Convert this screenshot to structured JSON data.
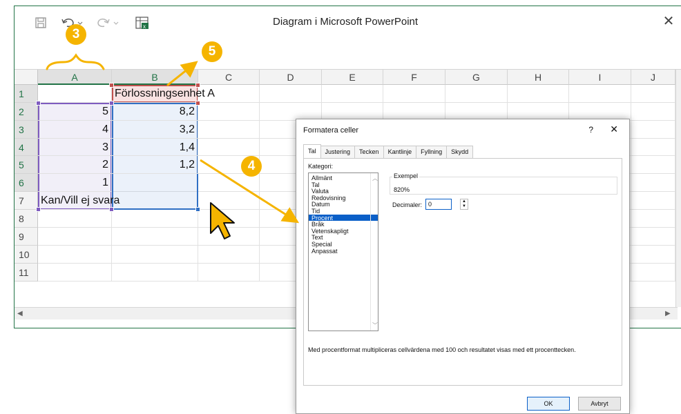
{
  "window": {
    "title": "Diagram i Microsoft PowerPoint",
    "close": "✕"
  },
  "columns": [
    "A",
    "B",
    "C",
    "D",
    "E",
    "F",
    "G",
    "H",
    "I",
    "J"
  ],
  "rows": [
    "1",
    "2",
    "3",
    "4",
    "5",
    "6",
    "7",
    "8",
    "9",
    "10",
    "11"
  ],
  "cells": {
    "B1": "Förlossningsenhet A",
    "A2": "5",
    "B2": "8,2",
    "A3": "4",
    "B3": "3,2",
    "A4": "3",
    "B4": "1,4",
    "A5": "2",
    "B5": "1,2",
    "A6": "1",
    "A7": "Kan/Vill ej svara"
  },
  "dialog": {
    "title": "Formatera celler",
    "help": "?",
    "close": "✕",
    "tabs": [
      "Tal",
      "Justering",
      "Tecken",
      "Kantlinje",
      "Fyllning",
      "Skydd"
    ],
    "category_label": "Kategori:",
    "categories": [
      "Allmänt",
      "Tal",
      "Valuta",
      "Redovisning",
      "Datum",
      "Tid",
      "Procent",
      "Bråk",
      "Vetenskapligt",
      "Text",
      "Special",
      "Anpassat"
    ],
    "selected_category": "Procent",
    "example_label": "Exempel",
    "example_value": "820%",
    "decimals_label": "Decimaler:",
    "decimals_value": "0",
    "description": "Med procentformat multipliceras cellvärdena med 100 och resultatet visas med ett procenttecken.",
    "ok": "OK",
    "cancel": "Avbryt"
  },
  "annotations": {
    "badge_3": "3",
    "badge_4": "4",
    "badge_5": "5",
    "accent_color": "#f5b400"
  }
}
